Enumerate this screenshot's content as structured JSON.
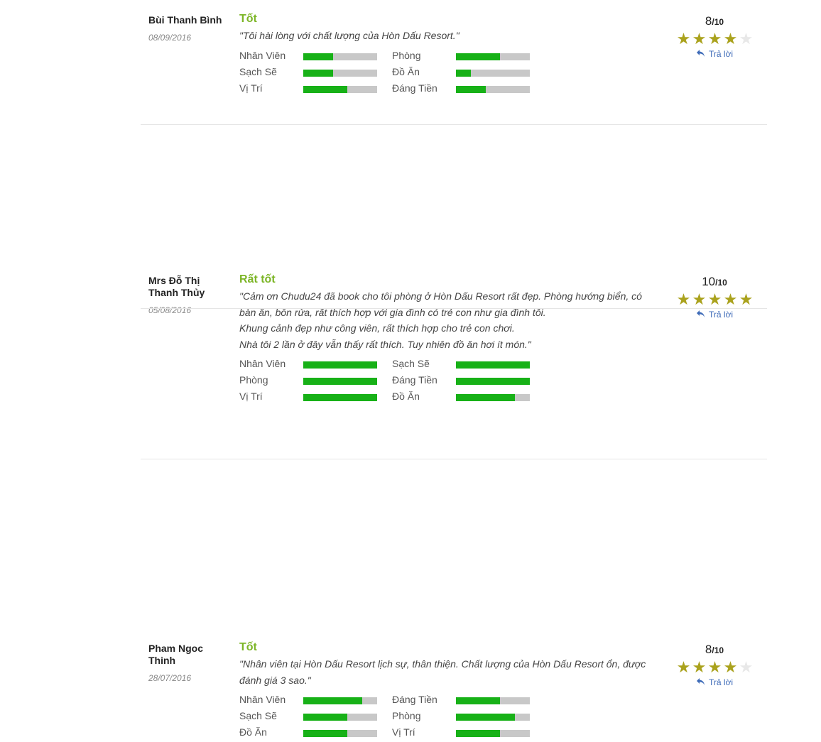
{
  "reviews": [
    {
      "name": "Bùi Thanh Bình",
      "date": "08/09/2016",
      "title": "Tốt",
      "comment_lines": [
        "\"Tôi hài lòng với chất lượng của Hòn Dấu Resort.\""
      ],
      "score": "8",
      "score_den": "/10",
      "stars": 4,
      "reply": "Trả lời",
      "criteria": [
        {
          "label": "Nhân Viên",
          "value": 0.4
        },
        {
          "label": "Phòng",
          "value": 0.6
        },
        {
          "label": "Sạch Sẽ",
          "value": 0.4
        },
        {
          "label": "Đồ Ăn",
          "value": 0.2
        },
        {
          "label": "Vị Trí",
          "value": 0.6
        },
        {
          "label": "Đáng Tiền",
          "value": 0.4
        }
      ]
    },
    {
      "name": "Mrs Đỗ Thị Thanh Thủy",
      "date": "05/08/2016",
      "title": "Rất tốt",
      "comment_lines": [
        "\"Cảm ơn Chudu24 đã book cho tôi phòng ở Hòn Dấu Resort rất đẹp. Phòng hướng biển, có",
        "bàn ăn, bồn rửa, rất thích hợp với gia đình có trẻ con như gia đình tôi.",
        "Khung cảnh đẹp như công viên, rất thích hợp cho trẻ con chơi.",
        "Nhà tôi 2 lần ở đây vẫn thấy rất thích. Tuy nhiên đồ ăn hơi ít món.\""
      ],
      "score": "10",
      "score_den": "/10",
      "stars": 5,
      "reply": "Trả lời",
      "criteria": [
        {
          "label": "Nhân Viên",
          "value": 1.0
        },
        {
          "label": "Sạch Sẽ",
          "value": 1.0
        },
        {
          "label": "Phòng",
          "value": 1.0
        },
        {
          "label": "Đáng Tiền",
          "value": 1.0
        },
        {
          "label": "Vị Trí",
          "value": 1.0
        },
        {
          "label": "Đồ Ăn",
          "value": 0.8
        }
      ]
    },
    {
      "name": "Pham Ngoc Thinh",
      "date": "28/07/2016",
      "title": "Tốt",
      "comment_lines": [
        "\"Nhân viên tại Hòn Dấu Resort lịch sự, thân thiện. Chất lượng của Hòn Dấu Resort ổn, được",
        "đánh giá 3 sao.\""
      ],
      "score": "8",
      "score_den": "/10",
      "stars": 4,
      "reply": "Trả lời",
      "criteria": [
        {
          "label": "Nhân Viên",
          "value": 0.8
        },
        {
          "label": "Đáng Tiền",
          "value": 0.6
        },
        {
          "label": "Sạch Sẽ",
          "value": 0.6
        },
        {
          "label": "Phòng",
          "value": 0.8
        },
        {
          "label": "Đồ Ăn",
          "value": 0.6
        },
        {
          "label": "Vị Trí",
          "value": 0.6
        }
      ]
    }
  ],
  "colors": {
    "title": "#7cb526",
    "bar_fill": "#17b117",
    "bar_bg": "#c8c8c8",
    "star_on": "#aaa21d",
    "star_off": "#e8e8e8",
    "reply": "#3e6bb8"
  },
  "icons": {
    "star": "star-icon",
    "reply": "reply-arrow-icon"
  }
}
